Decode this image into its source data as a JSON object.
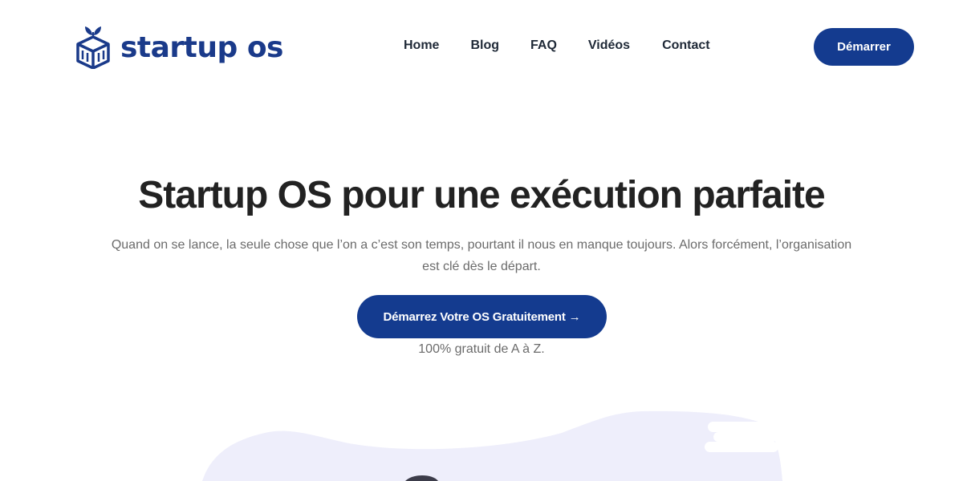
{
  "brand": {
    "name": "startup os",
    "color": "#1a3a8a"
  },
  "nav": {
    "items": [
      {
        "label": "Home"
      },
      {
        "label": "Blog"
      },
      {
        "label": "FAQ"
      },
      {
        "label": "Vidéos"
      },
      {
        "label": "Contact"
      }
    ]
  },
  "header": {
    "cta_label": "Démarrer"
  },
  "hero": {
    "title": "Startup OS pour une exécution parfaite",
    "subtitle": "Quand on se lance, la seule chose que l’on a c’est son temps, pourtant il nous en manque toujours. Alors forcément, l’organisation est clé dès le départ.",
    "cta_label": "Démarrez Votre OS Gratuitement →",
    "note": "100% gratuit de A à Z."
  },
  "colors": {
    "primary": "#143b8f",
    "illustration_bg": "#eeeefb",
    "text_dark": "#222222",
    "text_muted": "#6b6b6b"
  },
  "icons": {
    "logo": "box-with-plant-icon"
  }
}
